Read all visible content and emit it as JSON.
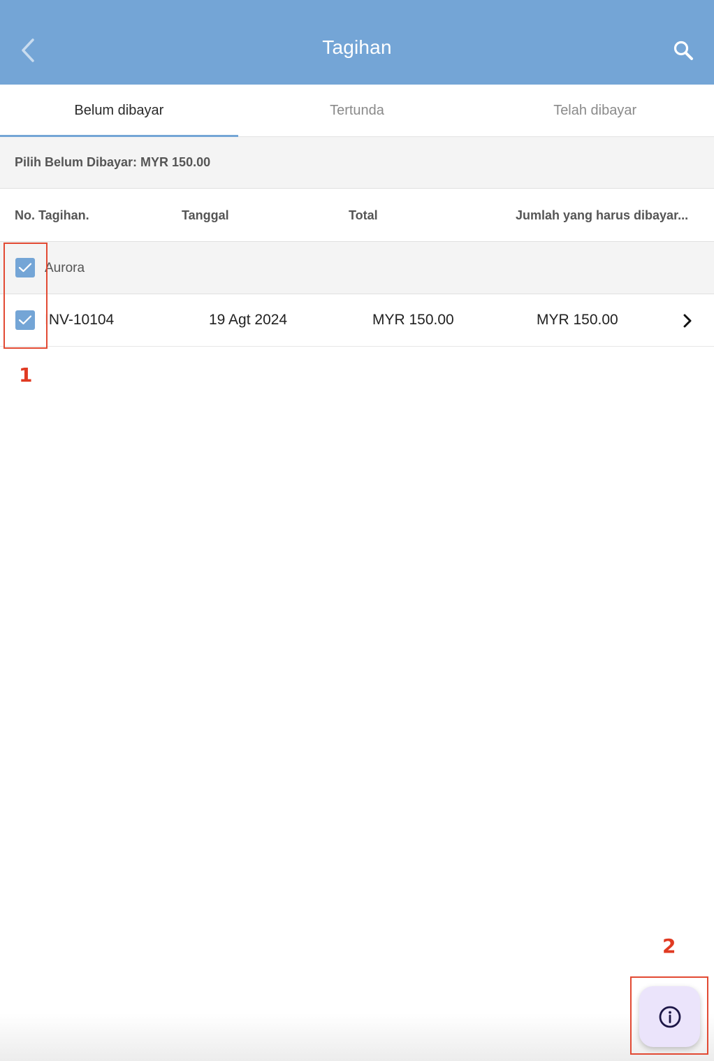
{
  "header": {
    "title": "Tagihan",
    "background_color": "#74a5d6",
    "back_icon": "chevron-left-icon",
    "search_icon": "search-icon"
  },
  "tabs": [
    {
      "label": "Belum dibayar",
      "active": true
    },
    {
      "label": "Tertunda",
      "active": false
    },
    {
      "label": "Telah dibayar",
      "active": false
    }
  ],
  "summary": {
    "text": "Pilih Belum Dibayar: MYR 150.00"
  },
  "columns": {
    "invoice_no": "No. Tagihan.",
    "date": "Tanggal",
    "total": "Total",
    "amount_due": "Jumlah yang harus dibayar..."
  },
  "group": {
    "label": "Aurora",
    "checked": true
  },
  "invoices": [
    {
      "number": "INV-10104",
      "date": "19 Agt 2024",
      "total": "MYR 150.00",
      "amount_due": "MYR 150.00",
      "checked": true
    }
  ],
  "annotations": {
    "marker_1": "1",
    "marker_2": "2",
    "color": "#e24a33"
  },
  "fab": {
    "icon": "info-icon",
    "background_color": "#ebe4fb"
  }
}
